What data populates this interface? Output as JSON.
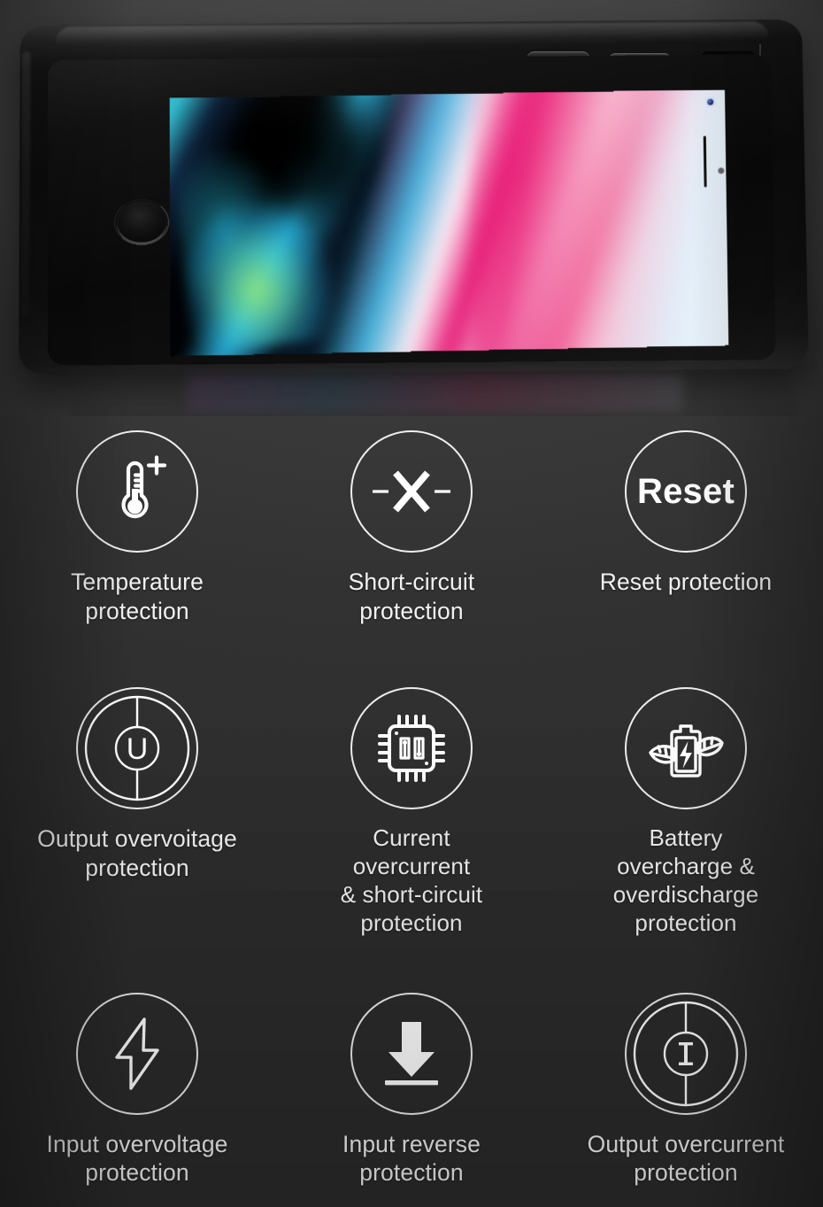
{
  "product": {
    "type": "battery-case-phone-photo",
    "device_label": "iPhone in black battery case",
    "screen_wallpaper": "abstract iPhone 8 gradient wallpaper",
    "visible_hardware": [
      "volume-up-button",
      "volume-down-button",
      "charging-port-cutout",
      "home-button",
      "front-camera",
      "earpiece-speaker",
      "proximity-sensor"
    ]
  },
  "colors": {
    "background": "#2f2f2f",
    "background_top": "#4a4a4a",
    "icon_stroke": "#ffffff",
    "label_text": "#f2f2f2",
    "case_body": "#0d0d0d"
  },
  "features": [
    {
      "id": "temperature-protection",
      "icon": "thermometer-plus-icon",
      "label": "Temperature\nprotection",
      "row": 1,
      "col": 1
    },
    {
      "id": "short-circuit-protection",
      "icon": "dash-x-dash-icon",
      "label": "Short-circuit\nprotection",
      "row": 1,
      "col": 2
    },
    {
      "id": "reset-protection",
      "icon": "reset-text-icon",
      "icon_text": "Reset",
      "label": "Reset protection",
      "row": 1,
      "col": 3
    },
    {
      "id": "output-overvoltage-protection",
      "icon": "voltage-u-symbol-icon",
      "label": "Output overvoitage\nprotection",
      "row": 2,
      "col": 1
    },
    {
      "id": "current-overcurrent-short-circuit-protection",
      "icon": "cpu-chip-icon",
      "label": "Current\novercurrent\n& short-circuit\nprotection",
      "row": 2,
      "col": 2
    },
    {
      "id": "battery-overcharge-overdischarge-protection",
      "icon": "battery-leaf-bolt-icon",
      "label": "Battery\novercharge &\noverdischarge\nprotection",
      "row": 2,
      "col": 3
    },
    {
      "id": "input-overvoltage-protection",
      "icon": "lightning-bolt-outline-icon",
      "label": "Input overvoltage\nprotection",
      "row": 3,
      "col": 1
    },
    {
      "id": "input-reverse-protection",
      "icon": "down-arrow-bar-icon",
      "label": "Input reverse\nprotection",
      "row": 3,
      "col": 2
    },
    {
      "id": "output-overcurrent-protection",
      "icon": "current-i-symbol-icon",
      "label": "Output overcurrent\nprotection",
      "row": 3,
      "col": 3
    }
  ]
}
